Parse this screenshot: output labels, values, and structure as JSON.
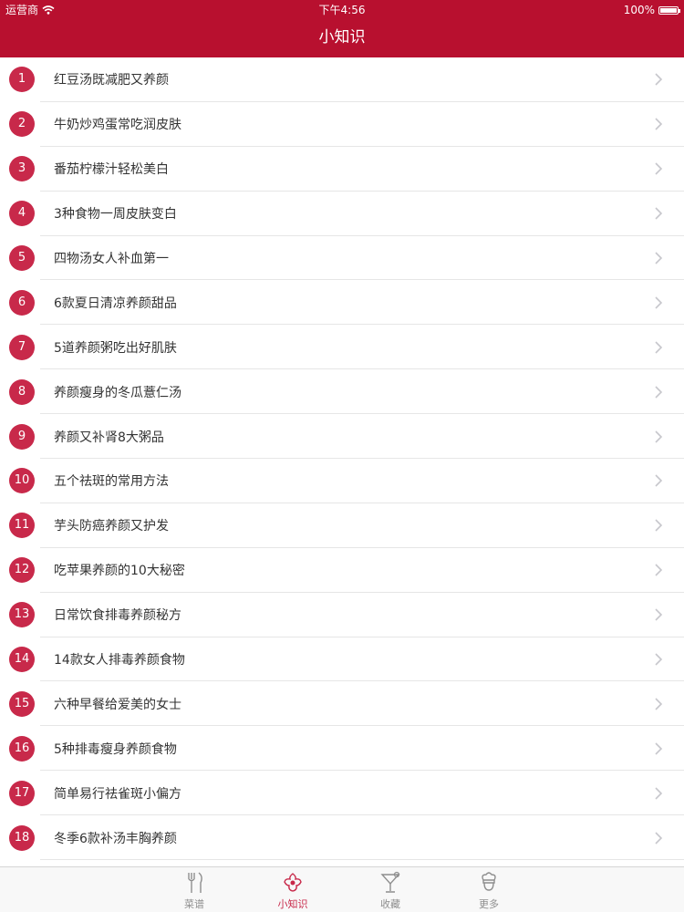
{
  "status_bar": {
    "carrier": "运营商",
    "time": "下午4:56",
    "battery": "100%"
  },
  "header": {
    "title": "小知识"
  },
  "items": [
    {
      "num": "1",
      "title": "红豆汤既减肥又养颜"
    },
    {
      "num": "2",
      "title": "牛奶炒鸡蛋常吃润皮肤"
    },
    {
      "num": "3",
      "title": "番茄柠檬汁轻松美白"
    },
    {
      "num": "4",
      "title": "3种食物一周皮肤变白"
    },
    {
      "num": "5",
      "title": "四物汤女人补血第一"
    },
    {
      "num": "6",
      "title": "6款夏日清凉养颜甜品"
    },
    {
      "num": "7",
      "title": "5道养颜粥吃出好肌肤"
    },
    {
      "num": "8",
      "title": "养颜瘦身的冬瓜薏仁汤"
    },
    {
      "num": "9",
      "title": "养颜又补肾8大粥品"
    },
    {
      "num": "10",
      "title": "五个祛斑的常用方法"
    },
    {
      "num": "11",
      "title": "芋头防癌养颜又护发"
    },
    {
      "num": "12",
      "title": "吃苹果养颜的10大秘密"
    },
    {
      "num": "13",
      "title": "日常饮食排毒养颜秘方"
    },
    {
      "num": "14",
      "title": "14款女人排毒养颜食物"
    },
    {
      "num": "15",
      "title": "六种早餐给爱美的女士"
    },
    {
      "num": "16",
      "title": "5种排毒瘦身养颜食物"
    },
    {
      "num": "17",
      "title": "简单易行祛雀斑小偏方"
    },
    {
      "num": "18",
      "title": "冬季6款补汤丰胸养颜"
    }
  ],
  "tabs": [
    {
      "label": "菜谱",
      "icon": "fork-knife-icon",
      "active": false
    },
    {
      "label": "小知识",
      "icon": "flower-icon",
      "active": true
    },
    {
      "label": "收藏",
      "icon": "cocktail-icon",
      "active": false
    },
    {
      "label": "更多",
      "icon": "chef-icon",
      "active": false
    }
  ],
  "colors": {
    "primary": "#b8102f",
    "badge": "#c8294a",
    "tab_inactive": "#8e8e8e"
  }
}
